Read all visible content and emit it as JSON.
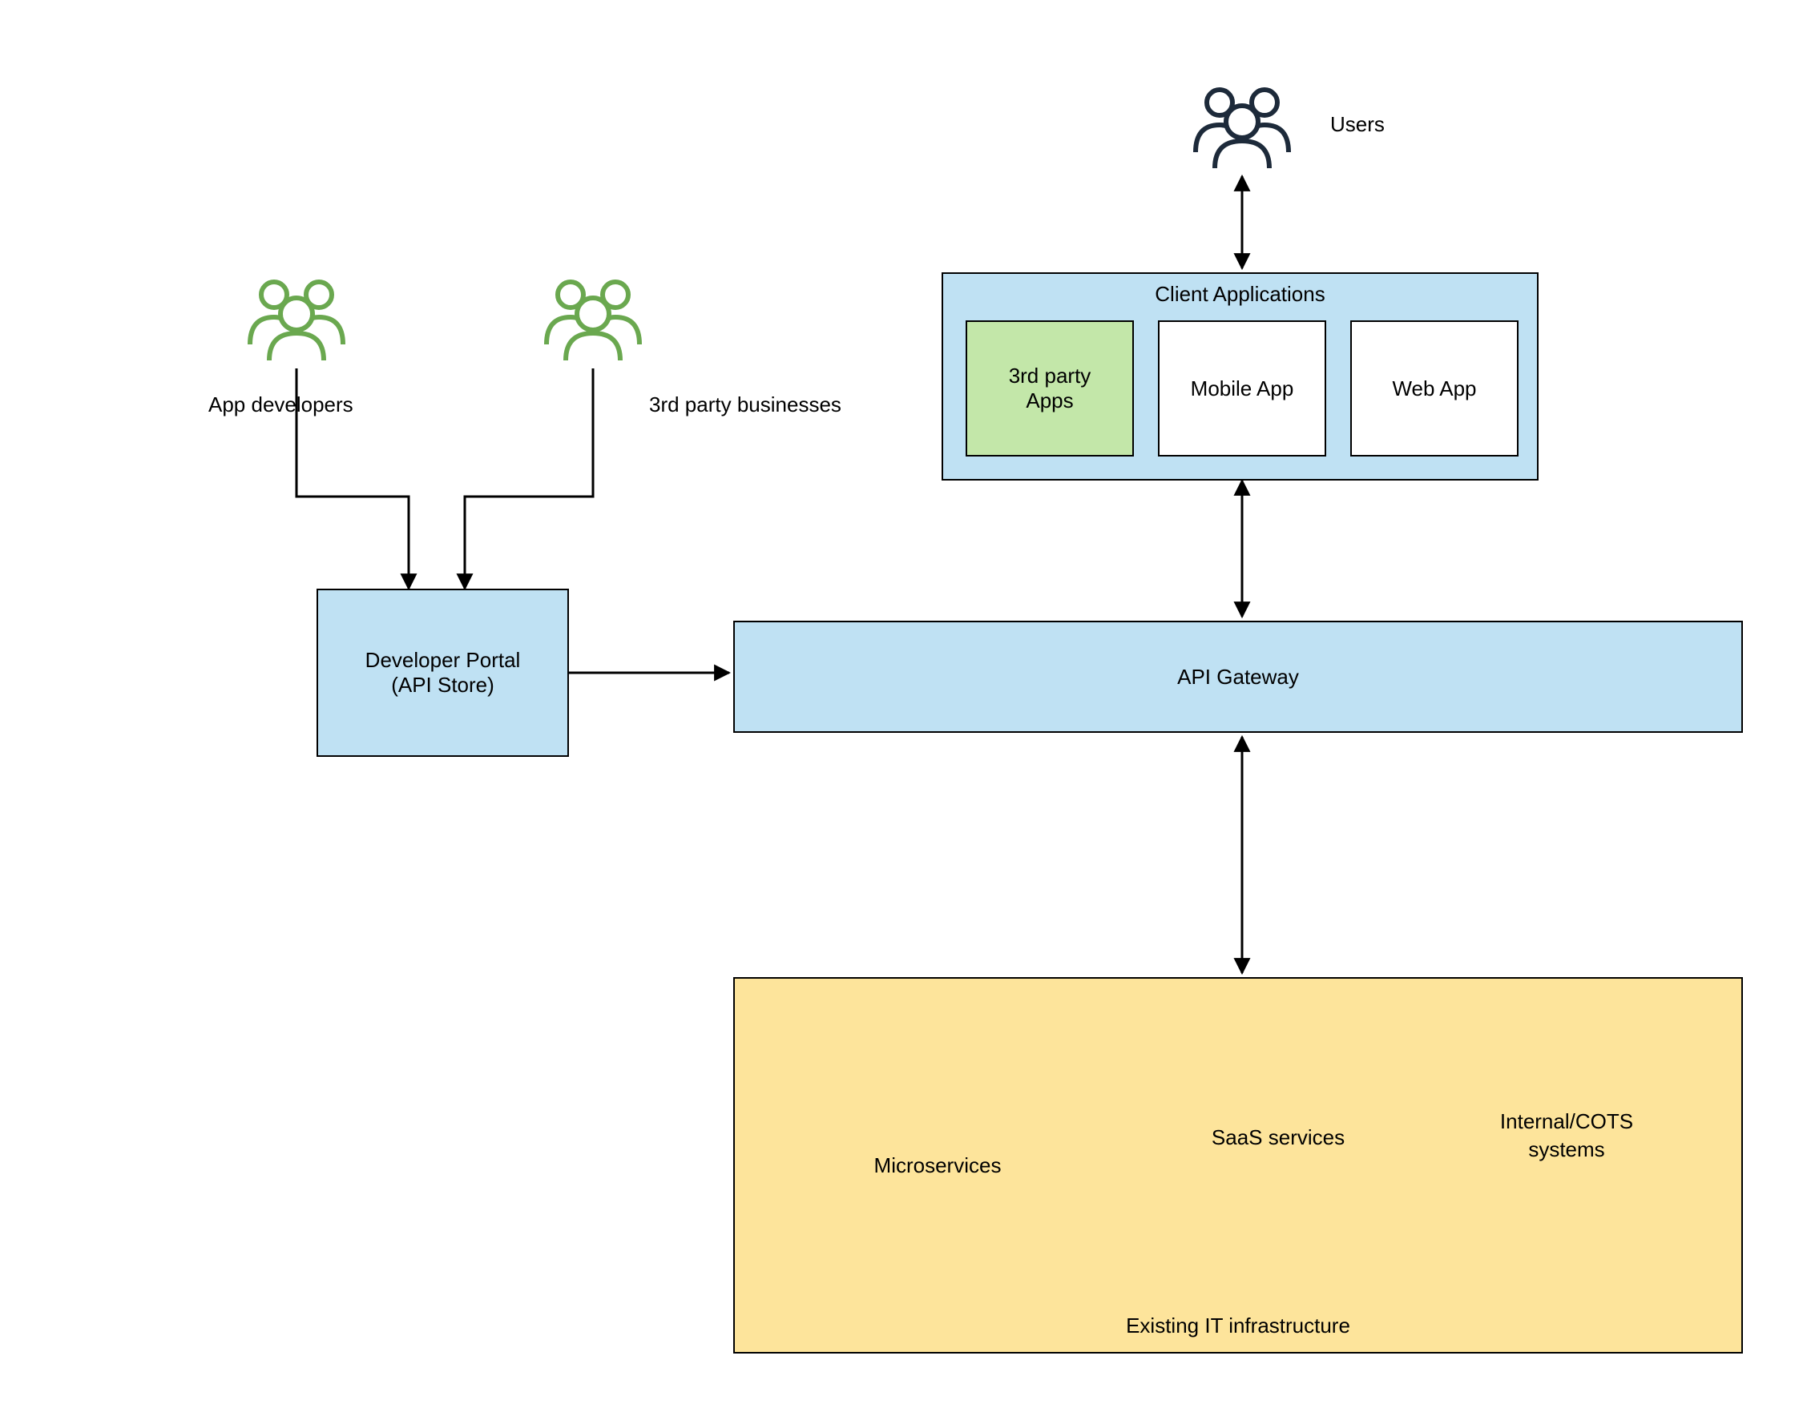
{
  "actors": {
    "app_devs": "App developers",
    "third_party_biz": "3rd party businesses",
    "users": "Users"
  },
  "boxes": {
    "developer_portal_line1": "Developer Portal",
    "developer_portal_line2": "(API Store)",
    "api_gateway": "API Gateway",
    "client_apps_title": "Client Applications",
    "third_party_apps_line1": "3rd party",
    "third_party_apps_line2": "Apps",
    "mobile_app": "Mobile App",
    "web_app": "Web App",
    "microservices": "Microservices",
    "saas": "SaaS services",
    "cots_line1": "Internal/COTS",
    "cots_line2": "systems",
    "infra_caption": "Existing IT infrastructure"
  },
  "colors": {
    "blue": "#bfe1f3",
    "green": "#c3e7a9",
    "amber": "#fde49b",
    "stroke": "#000000",
    "actor_green": "#6aa84f",
    "actor_dark": "#1d2a3a"
  }
}
